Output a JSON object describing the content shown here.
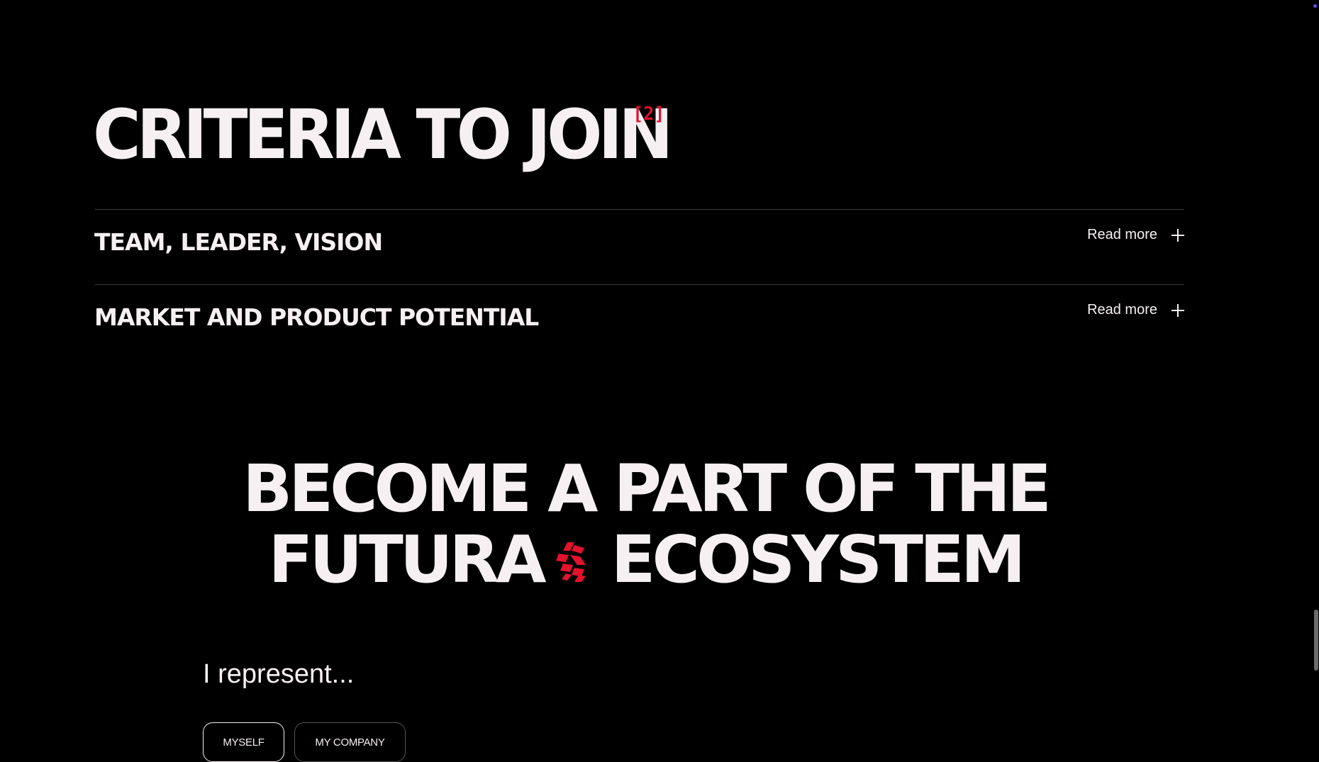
{
  "criteria": {
    "title": "CRITERIA TO JOIN",
    "index": "[2]"
  },
  "accordion": [
    {
      "title": "TEAM, LEADER, VISION",
      "action": "Read more"
    },
    {
      "title": "MARKET AND PRODUCT POTENTIAL",
      "action": "Read more"
    }
  ],
  "cta": {
    "line1": "BECOME A PART OF THE",
    "line2_before": "FUTURA",
    "line2_after": "ECOSYSTEM",
    "logo_icon": "futura-logo-icon",
    "accent": "#e3122d"
  },
  "form": {
    "prompt": "I represent...",
    "options": [
      "MYSELF",
      "MY COMPANY"
    ],
    "selected": "MYSELF"
  },
  "colors": {
    "background": "#000000",
    "text": "#f7f0f3",
    "accent": "#e3122d"
  }
}
